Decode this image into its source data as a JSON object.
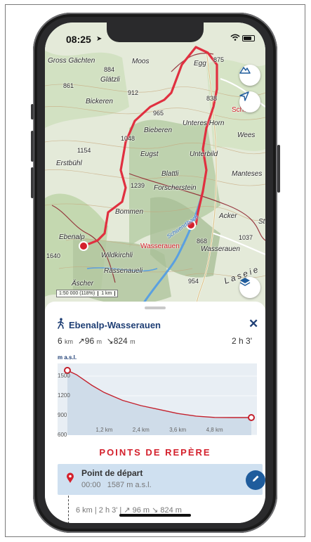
{
  "status_bar": {
    "time": "08:25",
    "location_glyph": "➤"
  },
  "map": {
    "labels": [
      {
        "text": "Gross Gächten",
        "kind": "place"
      },
      {
        "text": "Moos",
        "kind": "place"
      },
      {
        "text": "884",
        "kind": "num"
      },
      {
        "text": "Glätzli",
        "kind": "place"
      },
      {
        "text": "861",
        "kind": "num"
      },
      {
        "text": "912",
        "kind": "num"
      },
      {
        "text": "Bickeren",
        "kind": "place"
      },
      {
        "text": "Egg",
        "kind": "place"
      },
      {
        "text": "875",
        "kind": "num"
      },
      {
        "text": "838",
        "kind": "num"
      },
      {
        "text": "965",
        "kind": "num"
      },
      {
        "text": "Unteres Horn",
        "kind": "place"
      },
      {
        "text": "Schw",
        "kind": "red"
      },
      {
        "text": "Wees",
        "kind": "place"
      },
      {
        "text": "Bieberen",
        "kind": "place"
      },
      {
        "text": "1048",
        "kind": "num"
      },
      {
        "text": "1154",
        "kind": "num"
      },
      {
        "text": "Eugst",
        "kind": "place"
      },
      {
        "text": "Unterbild",
        "kind": "place"
      },
      {
        "text": "Erstbühl",
        "kind": "place"
      },
      {
        "text": "Blattli",
        "kind": "place"
      },
      {
        "text": "Manteses",
        "kind": "place"
      },
      {
        "text": "1239",
        "kind": "num"
      },
      {
        "text": "Forscherstein",
        "kind": "place"
      },
      {
        "text": "Bommen",
        "kind": "place"
      },
      {
        "text": "Acker",
        "kind": "place"
      },
      {
        "text": "St",
        "kind": "place"
      },
      {
        "text": "Ebenalp",
        "kind": "place"
      },
      {
        "text": "Schwendibach",
        "kind": "blue"
      },
      {
        "text": "868",
        "kind": "num"
      },
      {
        "text": "1037",
        "kind": "num"
      },
      {
        "text": "1640",
        "kind": "num"
      },
      {
        "text": "Wildkirchli",
        "kind": "place"
      },
      {
        "text": "Wasserauen",
        "kind": "red"
      },
      {
        "text": "Wasserauen",
        "kind": "place"
      },
      {
        "text": "Rässenaueli",
        "kind": "place"
      },
      {
        "text": "Äscher",
        "kind": "place"
      },
      {
        "text": "954",
        "kind": "num"
      },
      {
        "text": "Laseie",
        "kind": "place"
      }
    ],
    "scale_text": "1:50 000 (118%)",
    "scale_bar": "1 km",
    "buttons": [
      "layers-icon",
      "locate-icon",
      "map-layers-icon"
    ]
  },
  "sheet": {
    "title": "Ebenalp-Wasserauen",
    "stats": {
      "distance": "6",
      "distance_unit": "km",
      "ascent_arrow": "↗",
      "ascent": "96",
      "ascent_unit": "m",
      "descent_arrow": "↘",
      "descent": "824",
      "descent_unit": "m",
      "duration": "2 h 3'"
    },
    "profile": {
      "unit": "m a.s.l.",
      "yticks": [
        "1500",
        "1200",
        "900",
        "600"
      ],
      "xticks": [
        "1,2 km",
        "2,4 km",
        "3,6 km",
        "4,8 km"
      ]
    },
    "section_title": "POINTS DE REPÈRE",
    "waypoint": {
      "name": "Point de départ",
      "time": "00:00",
      "altitude": "1587 m a.s.l."
    },
    "segment": "6 km | 2 h 3' | ↗ 96 m ↘ 824 m"
  },
  "colors": {
    "route": "#d4202c",
    "accent": "#1f3f75",
    "edit_button": "#1f5c9c",
    "waypoint_bg": "#cfe0f0"
  },
  "chart_data": {
    "type": "area",
    "xlabel": "",
    "ylabel": "m a.s.l.",
    "x": [
      0,
      0.3,
      0.8,
      1.2,
      1.8,
      2.4,
      3.0,
      3.6,
      4.2,
      4.8,
      5.4,
      6.0
    ],
    "y": [
      1587,
      1520,
      1360,
      1250,
      1130,
      1050,
      990,
      930,
      890,
      870,
      868,
      868
    ],
    "ylim": [
      600,
      1650
    ],
    "xlim": [
      0,
      6.0
    ],
    "xticks": [
      "1,2 km",
      "2,4 km",
      "3,6 km",
      "4,8 km"
    ],
    "yticks": [
      "1500",
      "1200",
      "900",
      "600"
    ],
    "grid": true
  }
}
